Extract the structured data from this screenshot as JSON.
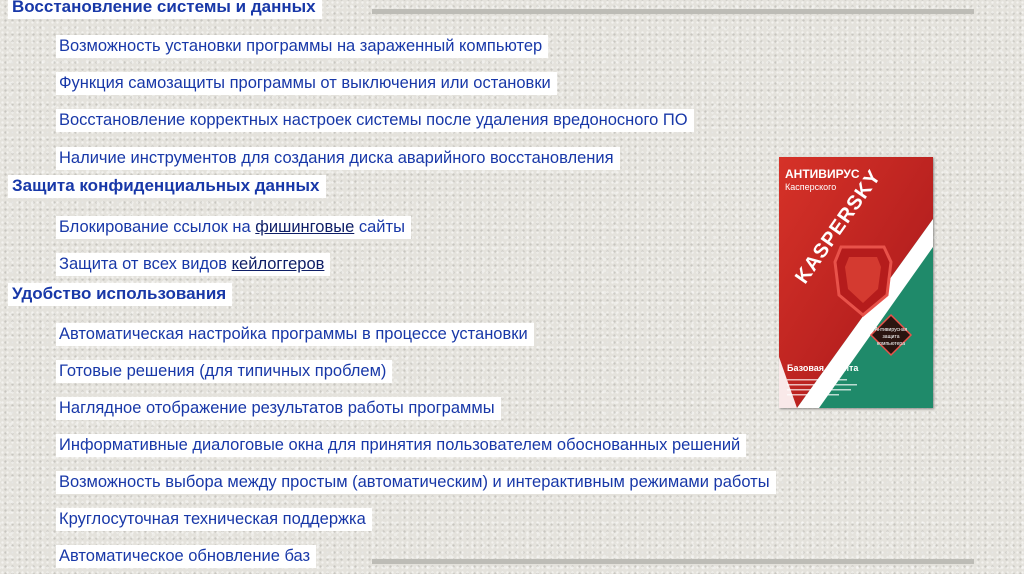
{
  "sections": [
    {
      "heading": "Восстановление системы и данных",
      "items": [
        "Возможность установки программы на зараженный компьютер",
        "Функция самозащиты программы от выключения или остановки",
        "Восстановление корректных настроек системы после удаления вредоносного ПО",
        "Наличие инструментов для создания диска аварийного восстановления"
      ]
    },
    {
      "heading": "Защита конфиденциальных данных",
      "items": [
        {
          "before": "Блокирование ссылок на ",
          "link": "фишинговые",
          "after": " сайты"
        },
        {
          "before": "Защита от всех видов ",
          "link": "кейлоггеров",
          "after": ""
        }
      ]
    },
    {
      "heading": "Удобство использования",
      "items": [
        "Автоматическая настройка программы в процессе установки",
        "Готовые решения (для типичных проблем)",
        "Наглядное отображение результатов работы программы",
        "Информативные диалоговые окна для принятия пользователем обоснованных решений",
        "Возможность выбора между простым (автоматическим) и интерактивным режимами работы",
        "Круглосуточная техническая поддержка",
        "Автоматическое обновление баз"
      ]
    }
  ],
  "product": {
    "line1": "АНТИВИРУС",
    "line2": "Касперского",
    "brand": "KASPERSKY",
    "edition": "Базовая защита",
    "badge": [
      "Антивирусная",
      "защита",
      "компьютера"
    ]
  },
  "colors": {
    "text": "#1838a8",
    "link": "#0e1e66",
    "box_red": "#c8241f",
    "box_green": "#1f8a6a"
  }
}
